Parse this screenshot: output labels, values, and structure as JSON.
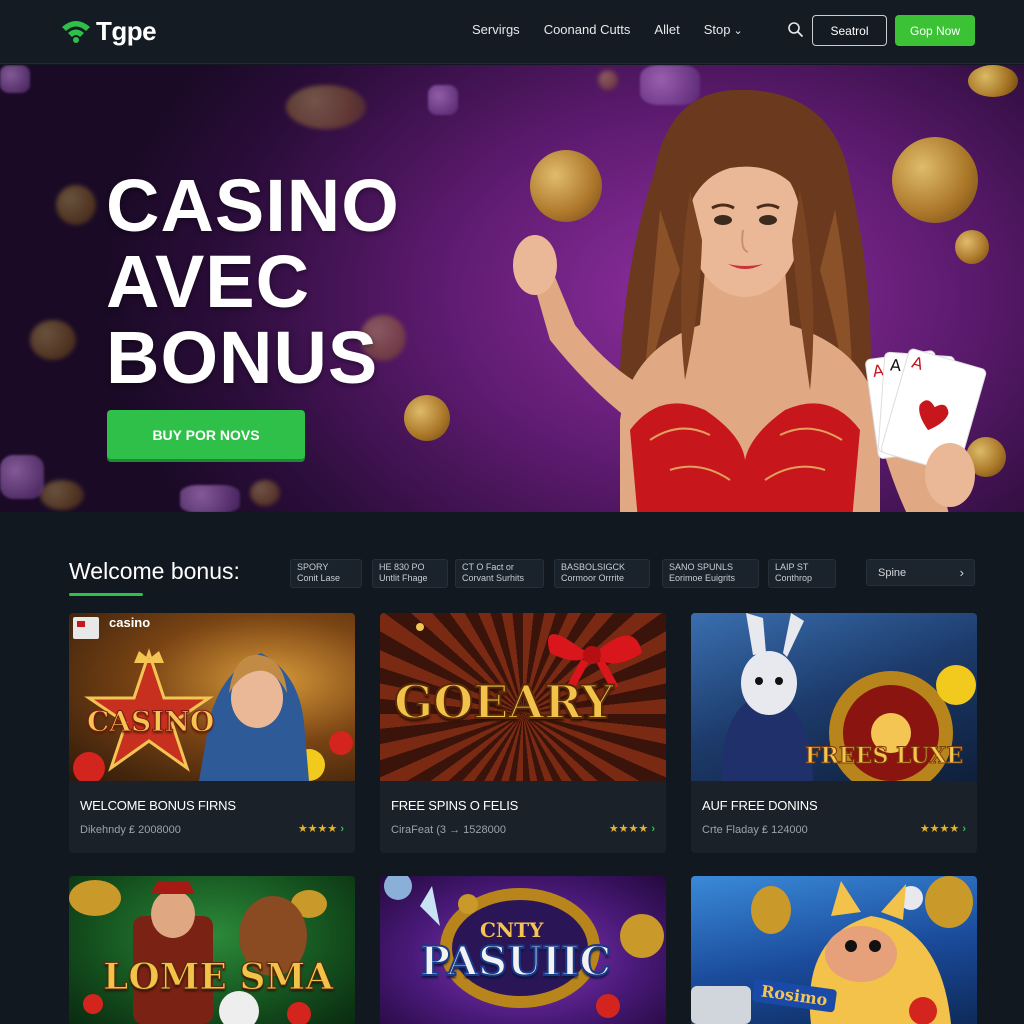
{
  "header": {
    "logo_text": "Tgpe",
    "nav": [
      {
        "label": "Servirgs",
        "caret": false
      },
      {
        "label": "Coonand Cutts",
        "caret": false
      },
      {
        "label": "Allet",
        "caret": false
      },
      {
        "label": "Stop",
        "caret": true
      }
    ],
    "outline_button": "Seatrol",
    "green_button": "Gop Now"
  },
  "hero": {
    "title_lines": [
      "CASINO",
      "AVEC",
      "BONUS"
    ],
    "cta": "BUY POR NOVS"
  },
  "welcome": {
    "title": "Welcome bonus:",
    "filters": [
      {
        "line1": "SPORY",
        "line2": "Conit Lase"
      },
      {
        "line1": "HE 830 PO",
        "line2": "Untlit Fhage"
      },
      {
        "line1": "CT O Fact or",
        "line2": "Corvant Surhits"
      },
      {
        "line1": "BASBOLSIGCK",
        "line2": "Cormoor Orrrite"
      },
      {
        "line1": "SANO SPUNLS",
        "line2": "Eorimoe Euigrits"
      },
      {
        "line1": "LAIP ST",
        "line2": "Conthrop"
      }
    ],
    "spin_button": "Spine"
  },
  "cards": [
    {
      "art_label": "CASINO",
      "art_badge": "casino",
      "title": "WELCOME BONUS FIRNS",
      "meta": "Dikehndy ₤ 2008000",
      "stars": "★★★★",
      "chev": "›"
    },
    {
      "art_label": "GOEARY",
      "title": "FREE SPINS O FELIS",
      "meta": "CiraFeat (3 → 1528000",
      "stars": "★★★★",
      "chev": "›"
    },
    {
      "art_label": "FREES LUXE",
      "title": "AUF FREE DONINS",
      "meta": "Crte Fladay ₤ 124000",
      "stars": "★★★★",
      "chev": "›"
    }
  ],
  "bottom_cards": [
    {
      "art_label": "LOME SMA"
    },
    {
      "art_label": "PASUIIC",
      "art_sub": "CNTY"
    },
    {
      "art_label": "Rosimo"
    }
  ],
  "colors": {
    "accent_green": "#2fc04a",
    "header_bg": "#141b22",
    "page_bg": "#111820",
    "card_bg": "#1a2129",
    "star": "#e5b52a"
  }
}
